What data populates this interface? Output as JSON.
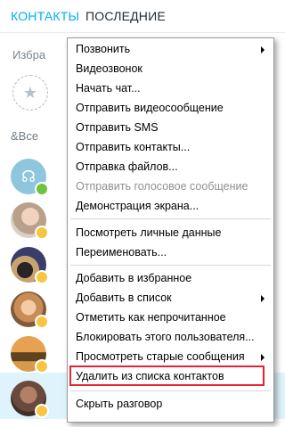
{
  "tabs": {
    "contacts": "КОНТАКТЫ",
    "recent": "ПОСЛЕДНИЕ"
  },
  "favorites": {
    "label": "Избра"
  },
  "contacts_header": {
    "label": "&Все"
  },
  "context_menu": {
    "items": [
      {
        "label": "Позвонить",
        "submenu": true
      },
      {
        "label": "Видеозвонок"
      },
      {
        "label": "Начать чат..."
      },
      {
        "label": "Отправить видеосообщение"
      },
      {
        "label": "Отправить SMS"
      },
      {
        "label": "Отправить контакты..."
      },
      {
        "label": "Отправка файлов..."
      },
      {
        "label": "Отправить голосовое сообщение",
        "disabled": true
      },
      {
        "label": "Демонстрация экрана..."
      },
      {
        "label": "Посмотреть личные данные"
      },
      {
        "label": "Переименовать..."
      },
      {
        "label": "Добавить в избранное"
      },
      {
        "label": "Добавить в список",
        "submenu": true
      },
      {
        "label": "Отметить как непрочитанное"
      },
      {
        "label": "Блокировать этого пользователя..."
      },
      {
        "label": "Просмотреть старые сообщения",
        "submenu": true
      },
      {
        "label": "Удалить из списка контактов",
        "highlighted": true
      },
      {
        "label": "Скрыть разговор"
      }
    ]
  },
  "colors": {
    "accent": "#00aff0",
    "highlight_box": "#e32636",
    "online": "#6fc23c",
    "away": "#f6c643"
  }
}
